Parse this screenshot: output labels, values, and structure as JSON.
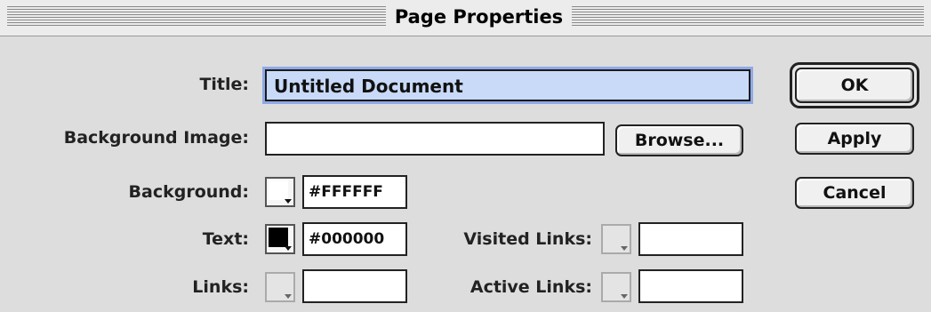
{
  "window": {
    "title": "Page Properties"
  },
  "fields": {
    "title_label": "Title:",
    "title_value": "Untitled Document",
    "background_image_label": "Background Image:",
    "background_image_value": "",
    "background_label": "Background:",
    "background_hex": "#FFFFFF",
    "text_label": "Text:",
    "text_hex": "#000000",
    "links_label": "Links:",
    "links_hex": "",
    "visited_links_label": "Visited Links:",
    "visited_links_hex": "",
    "active_links_label": "Active Links:",
    "active_links_hex": ""
  },
  "buttons": {
    "browse": "Browse...",
    "ok": "OK",
    "apply": "Apply",
    "cancel": "Cancel"
  },
  "colors": {
    "background_swatch": "#FFFFFF",
    "text_swatch": "#000000",
    "title_selection": "#c8daf8"
  }
}
